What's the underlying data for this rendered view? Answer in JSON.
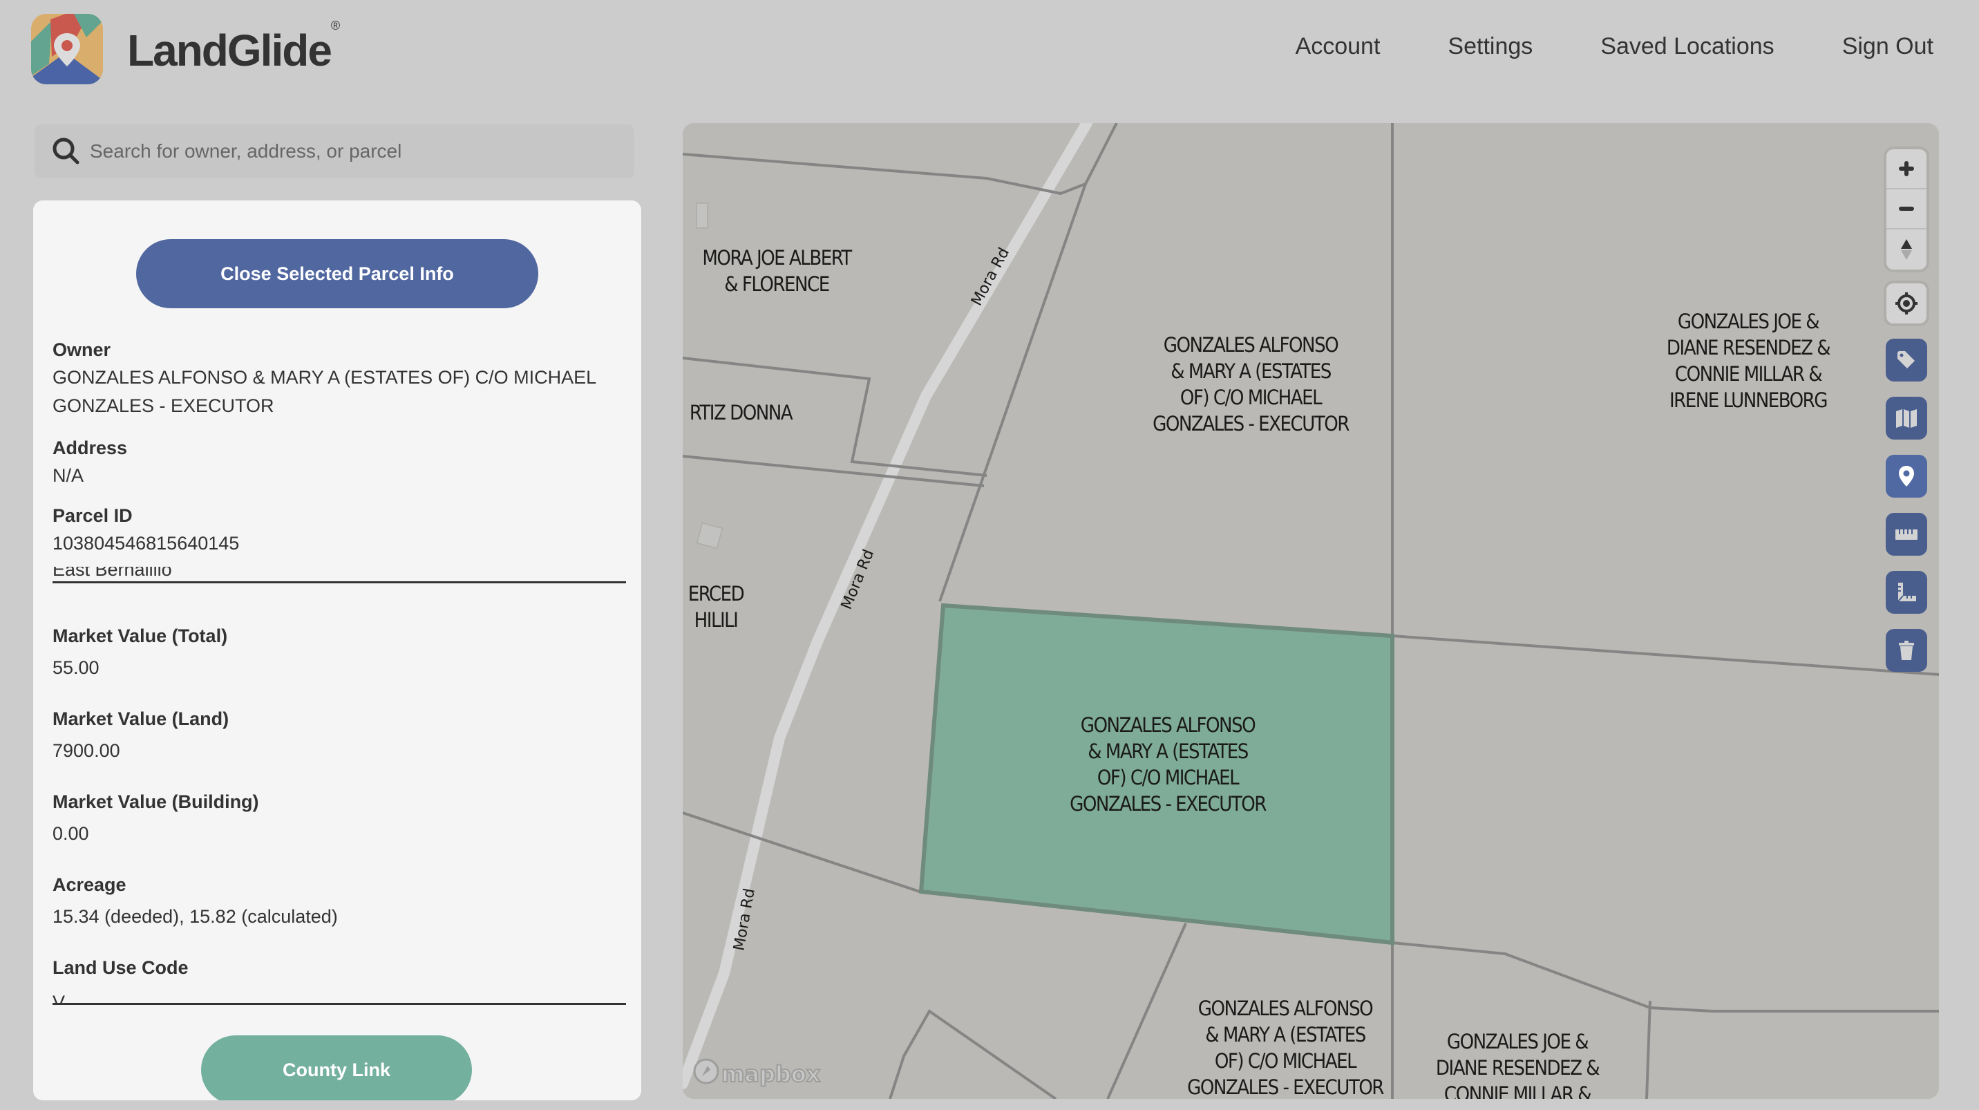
{
  "header": {
    "brand": "LandGlide",
    "brand_mark": "®",
    "logo_icon": "landglide-logo-icon",
    "nav": [
      {
        "label": "Account"
      },
      {
        "label": "Settings"
      },
      {
        "label": "Saved Locations"
      },
      {
        "label": "Sign Out"
      }
    ]
  },
  "search": {
    "icon": "search-icon",
    "placeholder": "Search for owner, address, or parcel",
    "value": ""
  },
  "panel": {
    "close_button": "Close Selected Parcel Info",
    "fields": {
      "owner": {
        "label": "Owner",
        "value_line1": "GONZALES ALFONSO & MARY A (ESTATES OF) C/O MICHAEL",
        "value_line2": "GONZALES - EXECUTOR"
      },
      "address": {
        "label": "Address",
        "value": "N/A"
      },
      "parcel_id": {
        "label": "Parcel ID",
        "value": "103804546815640145"
      },
      "clipped_value": "East Bernalillo",
      "market_total": {
        "label": "Market Value (Total)",
        "value": "55.00"
      },
      "market_land": {
        "label": "Market Value (Land)",
        "value": "7900.00"
      },
      "market_building": {
        "label": "Market Value (Building)",
        "value": "0.00"
      },
      "acreage": {
        "label": "Acreage",
        "value": "15.34 (deeded), 15.82 (calculated)"
      },
      "land_use": {
        "label": "Land Use Code",
        "value": "V"
      }
    },
    "county_button": "County Link"
  },
  "map": {
    "attribution": "mapbox",
    "road_name": "Mora Rd",
    "selected_fill": "#7fac98",
    "parcel_labels": [
      {
        "lines": [
          "MORA JOE ALBERT",
          "& FLORENCE"
        ]
      },
      {
        "lines": [
          "RTIZ DONNA"
        ]
      },
      {
        "lines": [
          "ERCED",
          "HILILI"
        ]
      },
      {
        "lines": [
          "GONZALES ALFONSO",
          "& MARY A (ESTATES",
          "OF) C/O MICHAEL",
          "GONZALES - EXECUTOR"
        ]
      },
      {
        "lines": [
          "GONZALES JOE &",
          "DIANE RESENDEZ &",
          "CONNIE MILLAR &",
          "IRENE LUNNEBORG"
        ]
      },
      {
        "lines": [
          "GONZALES ALFONSO",
          "& MARY A (ESTATES",
          "OF) C/O MICHAEL",
          "GONZALES - EXECUTOR"
        ]
      },
      {
        "lines": [
          "GONZALES ALFONSO",
          "& MARY A (ESTATES",
          "OF) C/O MICHAEL",
          "GONZALES - EXECUTOR"
        ]
      },
      {
        "lines": [
          "GONZALES JOE &",
          "DIANE RESENDEZ &",
          "CONNIE MILLAR &"
        ]
      }
    ],
    "controls": {
      "zoom_in": "plus-icon",
      "zoom_out": "minus-icon",
      "compass": "compass-icon",
      "geolocate": "geolocate-icon",
      "tools": [
        "tag-icon",
        "map-icon",
        "pin-icon",
        "ruler-icon",
        "area-ruler-icon",
        "trash-icon"
      ],
      "active_tool": "pin-icon"
    }
  },
  "colors": {
    "primary_button": "#51679f",
    "secondary_button": "#74b09e",
    "tool_button": "#4a5e8e",
    "map_bg": "#bab9b5",
    "parcel_line": "#858585"
  }
}
